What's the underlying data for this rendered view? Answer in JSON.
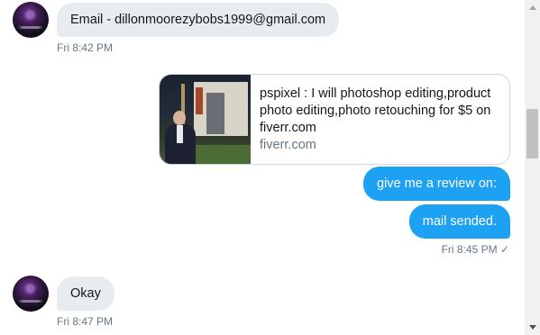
{
  "messages": {
    "email_text": "Email - dillonmoorezybobs1999@gmail.com",
    "email_time": "Fri 8:42 PM",
    "link_card": {
      "title": "pspixel : I will photoshop editing,product photo editing,photo retouching for $5 on fiverr.com",
      "domain": "fiverr.com"
    },
    "review_text": "give me a review on:",
    "mail_text": "mail sended.",
    "sent_time": "Fri 8:45 PM",
    "sent_status_icon": "checkmark-icon",
    "sent_status_glyph": "✓",
    "okay_text": "Okay",
    "okay_time": "Fri 8:47 PM"
  },
  "colors": {
    "incoming_bubble": "#e6ecf0",
    "outgoing_bubble": "#1da1f2",
    "timestamp": "#657786"
  }
}
